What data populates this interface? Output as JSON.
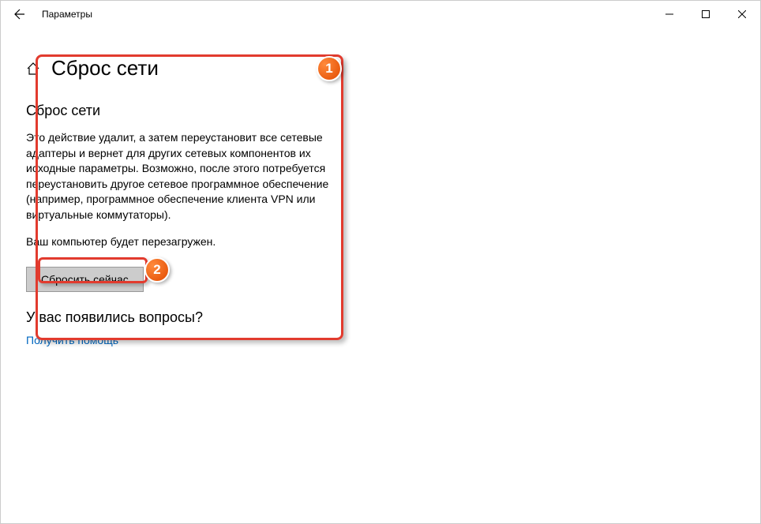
{
  "window": {
    "title": "Параметры"
  },
  "page": {
    "title": "Сброс сети"
  },
  "section": {
    "title": "Сброс сети",
    "description": "Это действие удалит, а затем переустановит все сетевые адаптеры и вернет для других сетевых компонентов их исходные параметры. Возможно, после этого потребуется переустановить другое сетевое программное обеспечение (например, программное обеспечение клиента VPN или виртуальные коммутаторы).",
    "restart_notice": "Ваш компьютер будет перезагружен.",
    "reset_button_label": "Сбросить сейчас"
  },
  "help": {
    "title": "У вас появились вопросы?",
    "link_label": "Получить помощь"
  },
  "annotations": {
    "badge1": "1",
    "badge2": "2"
  }
}
